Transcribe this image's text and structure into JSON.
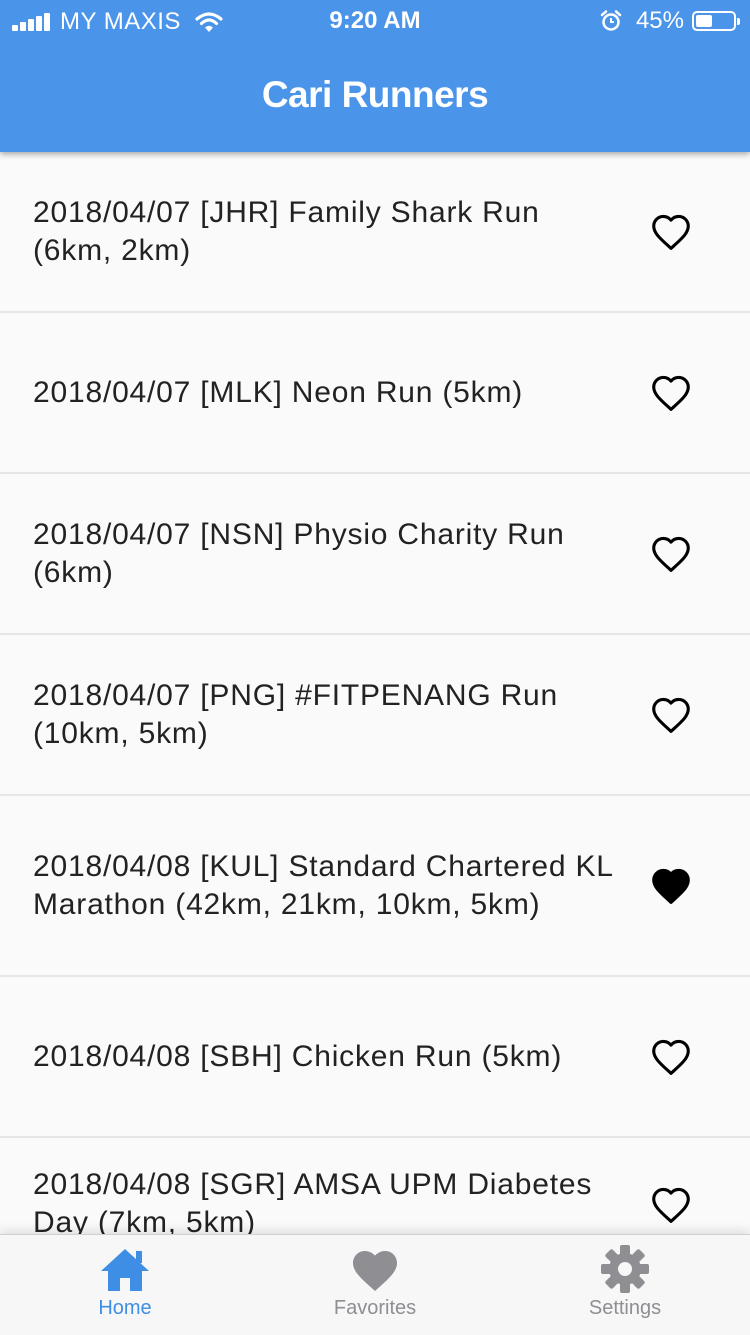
{
  "status_bar": {
    "carrier": "MY MAXIS",
    "time": "9:20 AM",
    "battery": "45%",
    "battery_level": 0.45,
    "icons": [
      "signal-icon",
      "wifi-icon",
      "alarm-icon",
      "battery-icon"
    ]
  },
  "header": {
    "title": "Cari Runners",
    "background": "#4a94ea"
  },
  "events": [
    {
      "text": "2018/04/07 [JHR] Family Shark Run (6km, 2km)",
      "favorite": false
    },
    {
      "text": "2018/04/07 [MLK] Neon Run (5km)",
      "favorite": false
    },
    {
      "text": "2018/04/07 [NSN] Physio Charity Run (6km)",
      "favorite": false
    },
    {
      "text": "2018/04/07 [PNG] #FITPENANG Run (10km, 5km)",
      "favorite": false
    },
    {
      "text": "2018/04/08 [KUL] Standard Chartered KL Marathon (42km, 21km, 10km, 5km)",
      "favorite": true
    },
    {
      "text": "2018/04/08 [SBH] Chicken Run (5km)",
      "favorite": false
    },
    {
      "text": "2018/04/08 [SGR] AMSA UPM Diabetes Day (7km, 5km)",
      "favorite": false
    }
  ],
  "tabs": [
    {
      "label": "Home",
      "icon": "home-icon",
      "active": true
    },
    {
      "label": "Favorites",
      "icon": "heart-icon",
      "active": false
    },
    {
      "label": "Settings",
      "icon": "gear-icon",
      "active": false
    }
  ],
  "colors": {
    "accent": "#3f8ee6",
    "inactive": "#8e8e93"
  }
}
